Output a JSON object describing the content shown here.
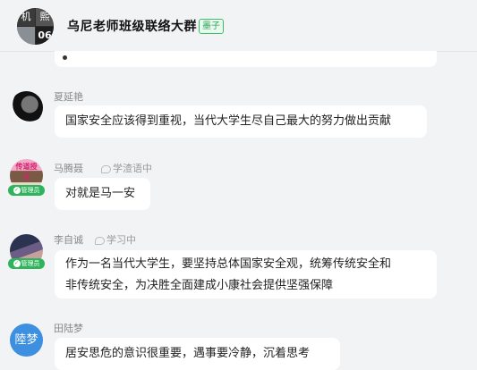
{
  "header": {
    "title": "乌尼老师班级联络大群",
    "tag": "墨子",
    "avatar_chars": [
      "机",
      "熙",
      "",
      "06"
    ]
  },
  "messages": [
    {
      "id": "xia",
      "name": "夏延艳",
      "status": "",
      "admin_badge": "",
      "lines": [
        "国家安全应该得到重视，当代大学生尽自己最大的努力做出贡献"
      ]
    },
    {
      "id": "ma",
      "name": "马腾聂",
      "status": "学渣语中",
      "admin_badge": "管理员",
      "avatar_text": "传道授业",
      "lines": [
        "对就是马一安"
      ]
    },
    {
      "id": "li",
      "name": "李自诚",
      "status": "学习中",
      "admin_badge": "管理员",
      "lines": [
        "作为一名当代大学生，要坚持总体国家安全观，统筹传统安全和",
        "非传统安全，为决胜全面建成小康社会提供坚强保障"
      ]
    },
    {
      "id": "tian",
      "name": "田陆梦",
      "status": "",
      "avatar_text": "陸梦",
      "lines": [
        "居安思危的意识很重要，遇事要冷静，沉着思考"
      ]
    }
  ],
  "colors": {
    "background": "#f2f3f5",
    "bubble": "#ffffff",
    "admin_badge": "#2fb35c",
    "tag": "#2aa857",
    "avatar_tian": "#3d8fe0"
  }
}
